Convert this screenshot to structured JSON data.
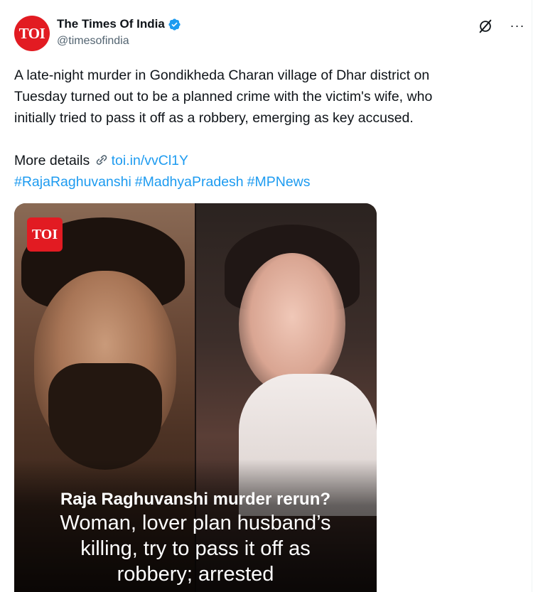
{
  "tweet": {
    "author": {
      "display_name": "The Times Of India",
      "handle": "@timesofindia",
      "avatar_text": "TOI",
      "verified": true,
      "avatar_color": "#e21b22"
    },
    "actions": {
      "grok_icon": "grok-icon",
      "more_label": "···"
    },
    "text": {
      "line1": "A late-night murder in Gondikheda Charan village of Dhar district on",
      "line2": "Tuesday turned out to be a planned crime with the victim's wife, who",
      "line3": "initially tried to pass it off as a robbery, emerging as key accused.",
      "more_details_label": "More details",
      "link_text": "toi.in/vvCl1Y",
      "hashtags": [
        "#RajaRaghuvanshi",
        "#MadhyaPradesh",
        "#MPNews"
      ]
    },
    "media": {
      "badge_text": "TOI",
      "caption_headline": "Raja Raghuvanshi murder rerun?",
      "caption_line1": "Woman, lover plan husband’s",
      "caption_line2": "killing, try to pass it off as",
      "caption_line3": "robbery; arrested"
    },
    "colors": {
      "link": "#1d9bf0",
      "text": "#0f1419",
      "secondary": "#536471",
      "brand_red": "#e21b22"
    }
  }
}
